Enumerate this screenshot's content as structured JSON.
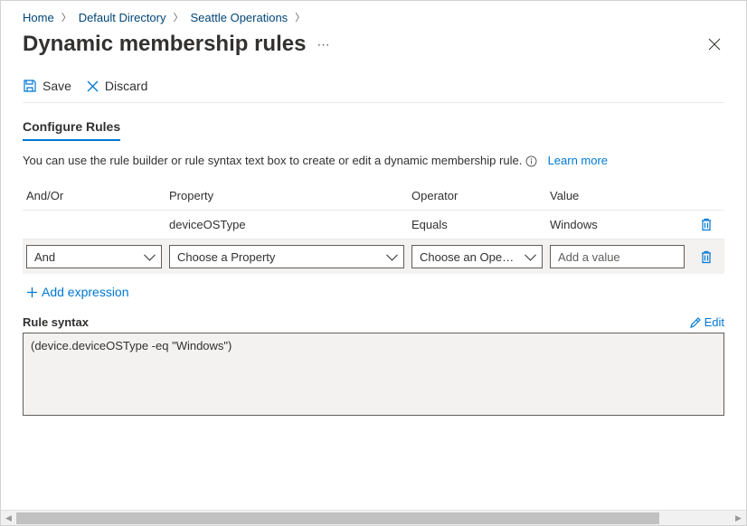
{
  "breadcrumb": {
    "items": [
      "Home",
      "Default Directory",
      "Seattle Operations"
    ]
  },
  "header": {
    "title": "Dynamic membership rules"
  },
  "toolbar": {
    "save_label": "Save",
    "discard_label": "Discard"
  },
  "section": {
    "configure_label": "Configure Rules",
    "description": "You can use the rule builder or rule syntax text box to create or edit a dynamic membership rule.",
    "learn_more": "Learn more"
  },
  "table": {
    "headers": {
      "andor": "And/Or",
      "property": "Property",
      "operator": "Operator",
      "value": "Value"
    },
    "rows": [
      {
        "andor": "",
        "property": "deviceOSType",
        "operator": "Equals",
        "value": "Windows"
      }
    ],
    "builder": {
      "andor_selected": "And",
      "property_placeholder": "Choose a Property",
      "operator_placeholder": "Choose an Ope…",
      "value_placeholder": "Add a value"
    }
  },
  "add_expression_label": "Add expression",
  "syntax": {
    "label": "Rule syntax",
    "edit_label": "Edit",
    "text": "(device.deviceOSType -eq \"Windows\")"
  }
}
